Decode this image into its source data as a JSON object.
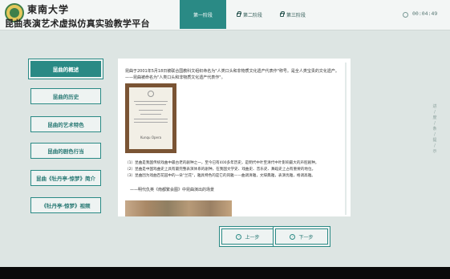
{
  "header": {
    "school_name": "東南大学",
    "platform_title": "昆曲表演艺术虚拟仿真实验教学平台",
    "tabs": [
      {
        "label": "第一阶段"
      },
      {
        "label": "第二阶段"
      },
      {
        "label": "第三阶段"
      }
    ],
    "timer": "00:04:49"
  },
  "sidebar": {
    "items": [
      {
        "label": "昆曲的概述"
      },
      {
        "label": "昆曲的历史"
      },
      {
        "label": "昆曲的艺术特色"
      },
      {
        "label": "昆曲的剧色行当"
      },
      {
        "label": "昆曲《牡丹亭·惊梦》简介"
      },
      {
        "label": "《牡丹亭·惊梦》视频"
      }
    ]
  },
  "content": {
    "intro_line1": "昆曲于2001年5月18日被联合国教科文组织命名为\"人类口头和非物质文化遗产代表作\"称号。是全人类宝贵的文化遗产。",
    "intro_line2": "——昆曲被命名为\"人类口头和非物质文化遗产代表作\"。",
    "certificate_title": "Kunqu Opera",
    "points": [
      "（1）昆曲是我国传统戏曲中最古老的剧种之一，至今已有400多年历史，是明代中叶至清代中叶影响最大的声腔剧种。",
      "（2）昆曲是中国戏曲史上具有最完整表演体系的剧种，在我国文学史、戏曲史、音乐史、舞蹈史上占有重要的地位。",
      "（3）昆曲因为戏曲百花园中的一朵\"兰花\"，雅具特色的是它的风雅——曲调清雅，文辞典雅，表演优雅，格调高雅。"
    ],
    "poem_caption": "——明代仇英《南都繁会图》中昆曲演出的场景"
  },
  "vertical_text": "进 / 度 / 条 / 提 / 示",
  "nav": {
    "prev_label": "上一步",
    "next_label": "下一步"
  }
}
